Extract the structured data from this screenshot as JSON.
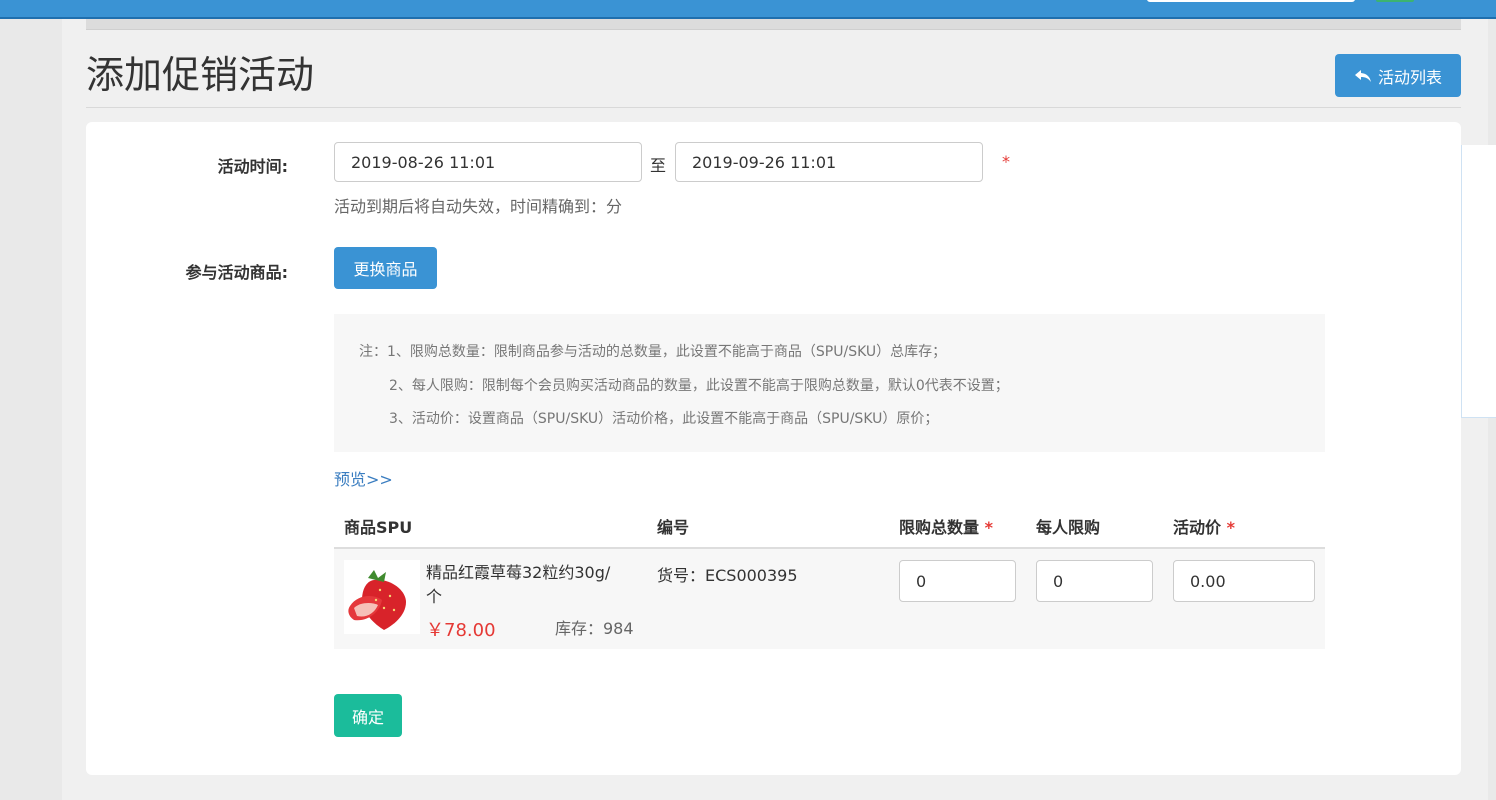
{
  "page": {
    "title": "添加促销活动",
    "list_button": "活动列表"
  },
  "form": {
    "time_label": "活动时间:",
    "start_time": "2019-08-26 11:01",
    "to_text": "至",
    "end_time": "2019-09-26 11:01",
    "required_mark": "*",
    "time_hint": "活动到期后将自动失效，时间精确到：分",
    "goods_label": "参与活动商品:",
    "change_goods_button": "更换商品",
    "notes": [
      "注：1、限购总数量：限制商品参与活动的总数量，此设置不能高于商品（SPU/SKU）总库存；",
      "2、每人限购：限制每个会员购买活动商品的数量，此设置不能高于限购总数量，默认0代表不设置；",
      "3、活动价：设置商品（SPU/SKU）活动价格，此设置不能高于商品（SPU/SKU）原价；"
    ],
    "preview_link": "预览>>",
    "confirm_button": "确定"
  },
  "table": {
    "headers": {
      "spu": "商品SPU",
      "code": "编号",
      "total_limit": "限购总数量",
      "per_person": "每人限购",
      "activity_price": "活动价"
    },
    "rows": [
      {
        "name": "精品红霞草莓32粒约30g/个",
        "price": "￥78.00",
        "stock": "库存：984",
        "sku": "货号：ECS000395",
        "total_limit": "0",
        "per_person": "0",
        "activity_price": "0.00"
      }
    ]
  },
  "colors": {
    "primary": "#3a93d4",
    "success": "#1bbc9b",
    "danger": "#e53935"
  }
}
